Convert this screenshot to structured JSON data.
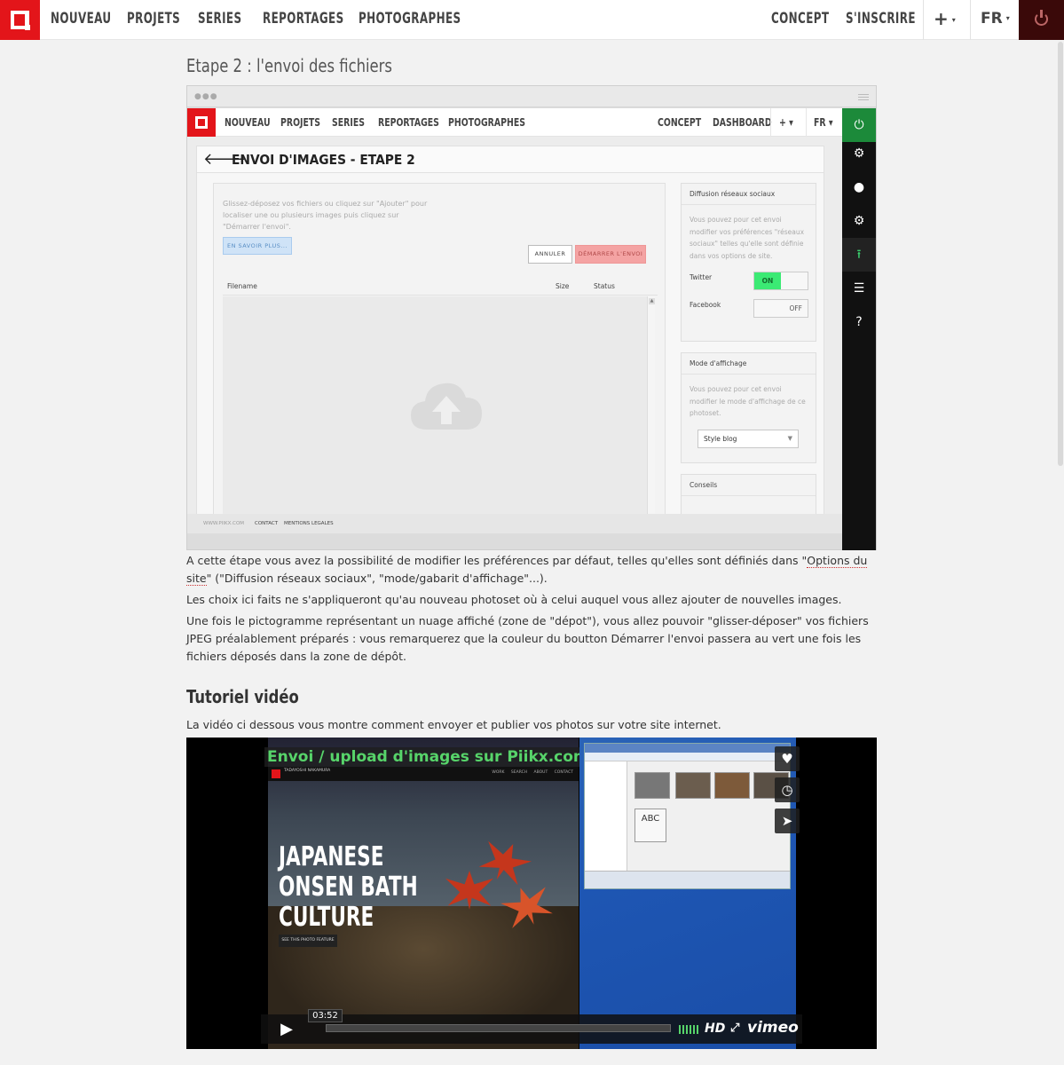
{
  "nav": {
    "items": [
      "NOUVEAU",
      "PROJETS",
      "SERIES",
      "REPORTAGES",
      "PHOTOGRAPHES"
    ],
    "right": [
      "CONCEPT",
      "S'INSCRIRE"
    ],
    "plus": "+",
    "lang": "FR",
    "caret": "▾",
    "power_icon": "power-icon"
  },
  "page": {
    "step_heading": "Etape 2 : l'envoi des fichiers",
    "para1_a": "A cette étape vous avez la possibilité de modifier les préférences par défaut, telles qu'elles sont définiés dans \"",
    "para1_link": "Options du site",
    "para1_b": "\" (\"Diffusion réseaux sociaux\", \"mode/gabarit d'affichage\"...).",
    "para2": "Les choix ici faits ne s'appliqueront qu'au nouveau photoset où à celui auquel vous allez ajouter de nouvelles images.",
    "para3": "Une fois le pictogramme représentant un nuage affiché (zone de \"dépot\"), vous allez pouvoir \"glisser-déposer\" vos fichiers JPEG préalablement préparés : vous remarquerez que la couleur du boutton Démarrer l'envoi passera au vert une fois les fichiers déposés dans la zone de dépôt.",
    "tutorial_heading": "Tutoriel vidéo",
    "tutorial_text": "La vidéo ci dessous vous montre comment envoyer et publier vos photos sur votre site internet."
  },
  "screenshot": {
    "dots": "●●●",
    "nav_items": [
      "NOUVEAU",
      "PROJETS",
      "SERIES",
      "REPORTAGES",
      "PHOTOGRAPHES"
    ],
    "nav_right": [
      "CONCEPT",
      "DASHBOARD"
    ],
    "plus": "+ ▾",
    "lang": "FR ▾",
    "back_arrow": "🡐",
    "title": "ENVOI D'IMAGES - ETAPE 2",
    "drop_help": "Glissez-déposez vos fichiers ou cliquez sur \"Ajouter\" pour localiser une ou plusieurs images puis cliquez sur \"Démarrer l'envoi\".",
    "btn_savoir": "EN SAVOIR PLUS...",
    "btn_annuler": "ANNULER",
    "btn_demarrer": "DÉMARRER L'ENVOI",
    "col_filename": "Filename",
    "col_size": "Size",
    "col_status": "Status",
    "scroll_up": "▲",
    "panel_social": {
      "title": "Diffusion réseaux sociaux",
      "text": "Vous pouvez pour cet envoi modifier vos préférences \"réseaux sociaux\" telles qu'elle sont définie dans vos options de site.",
      "twitter": "Twitter",
      "twitter_state": "ON",
      "facebook": "Facebook",
      "facebook_state": "OFF"
    },
    "panel_mode": {
      "title": "Mode d'affichage",
      "text": "Vous pouvez pour cet envoi modifier le mode d'affichage de ce photoset.",
      "select_value": "Style blog",
      "select_caret": "▼"
    },
    "panel_tips": {
      "title": "Conseils"
    },
    "footer_site": "WWW.PIIKX.COM",
    "footer_contact": "CONTACT",
    "footer_mentions": "MENTIONS LEGALES",
    "sidebar_icons": [
      "power-icon",
      "gear-icon",
      "user-icon",
      "cogs-icon",
      "upload-icon",
      "list-icon",
      "help-icon"
    ],
    "sidebar_glyphs": [
      "⏻",
      "⚙",
      "●",
      "⚙",
      "⭱",
      "☰",
      "?"
    ]
  },
  "video": {
    "title": "Envoi / upload d'images sur Piikx.com",
    "headline": "JAPANESE\nONSEN BATH\nCULTURE",
    "see_button": "SEE THIS PHOTO FEATURE",
    "site_name": "TADAYOSHI NAKAMURA",
    "site_nav": "WORK SEARCH ABOUT CONTACT",
    "abc": "ABC",
    "time": "03:52",
    "hd": "HD",
    "fullscreen": "⤢",
    "vimeo": "vimeo",
    "play": "▶",
    "like_icon": "♥",
    "later_icon": "◷",
    "share_icon": "➤"
  }
}
